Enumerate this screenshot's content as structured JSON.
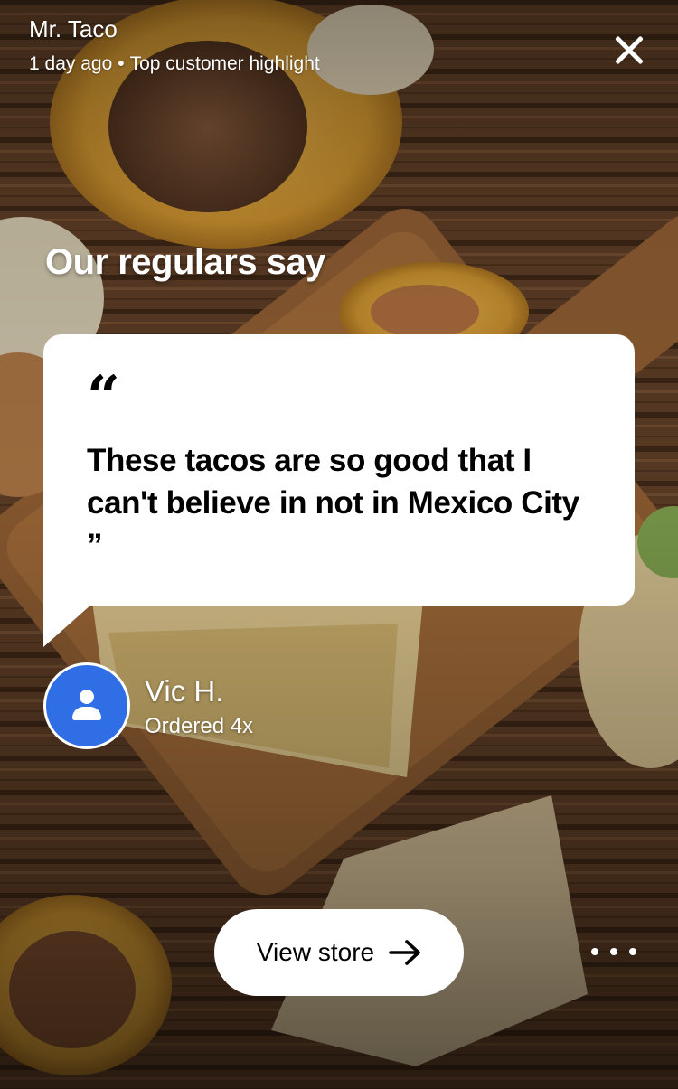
{
  "header": {
    "store_name": "Mr. Taco",
    "posted": "1 day ago",
    "separator": "•",
    "tag": "Top customer highlight"
  },
  "heading": "Our regulars say",
  "review": {
    "open_quote": "“",
    "text": "These tacos are so good that I can't believe in not in Mexico City ”",
    "reviewer_name": "Vic H.",
    "order_count": "Ordered 4x"
  },
  "actions": {
    "view_store_label": "View store"
  },
  "colors": {
    "avatar_bg": "#2f6ee4",
    "bubble_bg": "#ffffff",
    "button_bg": "#ffffff"
  },
  "icons": {
    "close": "close-icon",
    "avatar": "person-icon",
    "arrow": "arrow-right-icon",
    "more": "more-horizontal-icon"
  }
}
